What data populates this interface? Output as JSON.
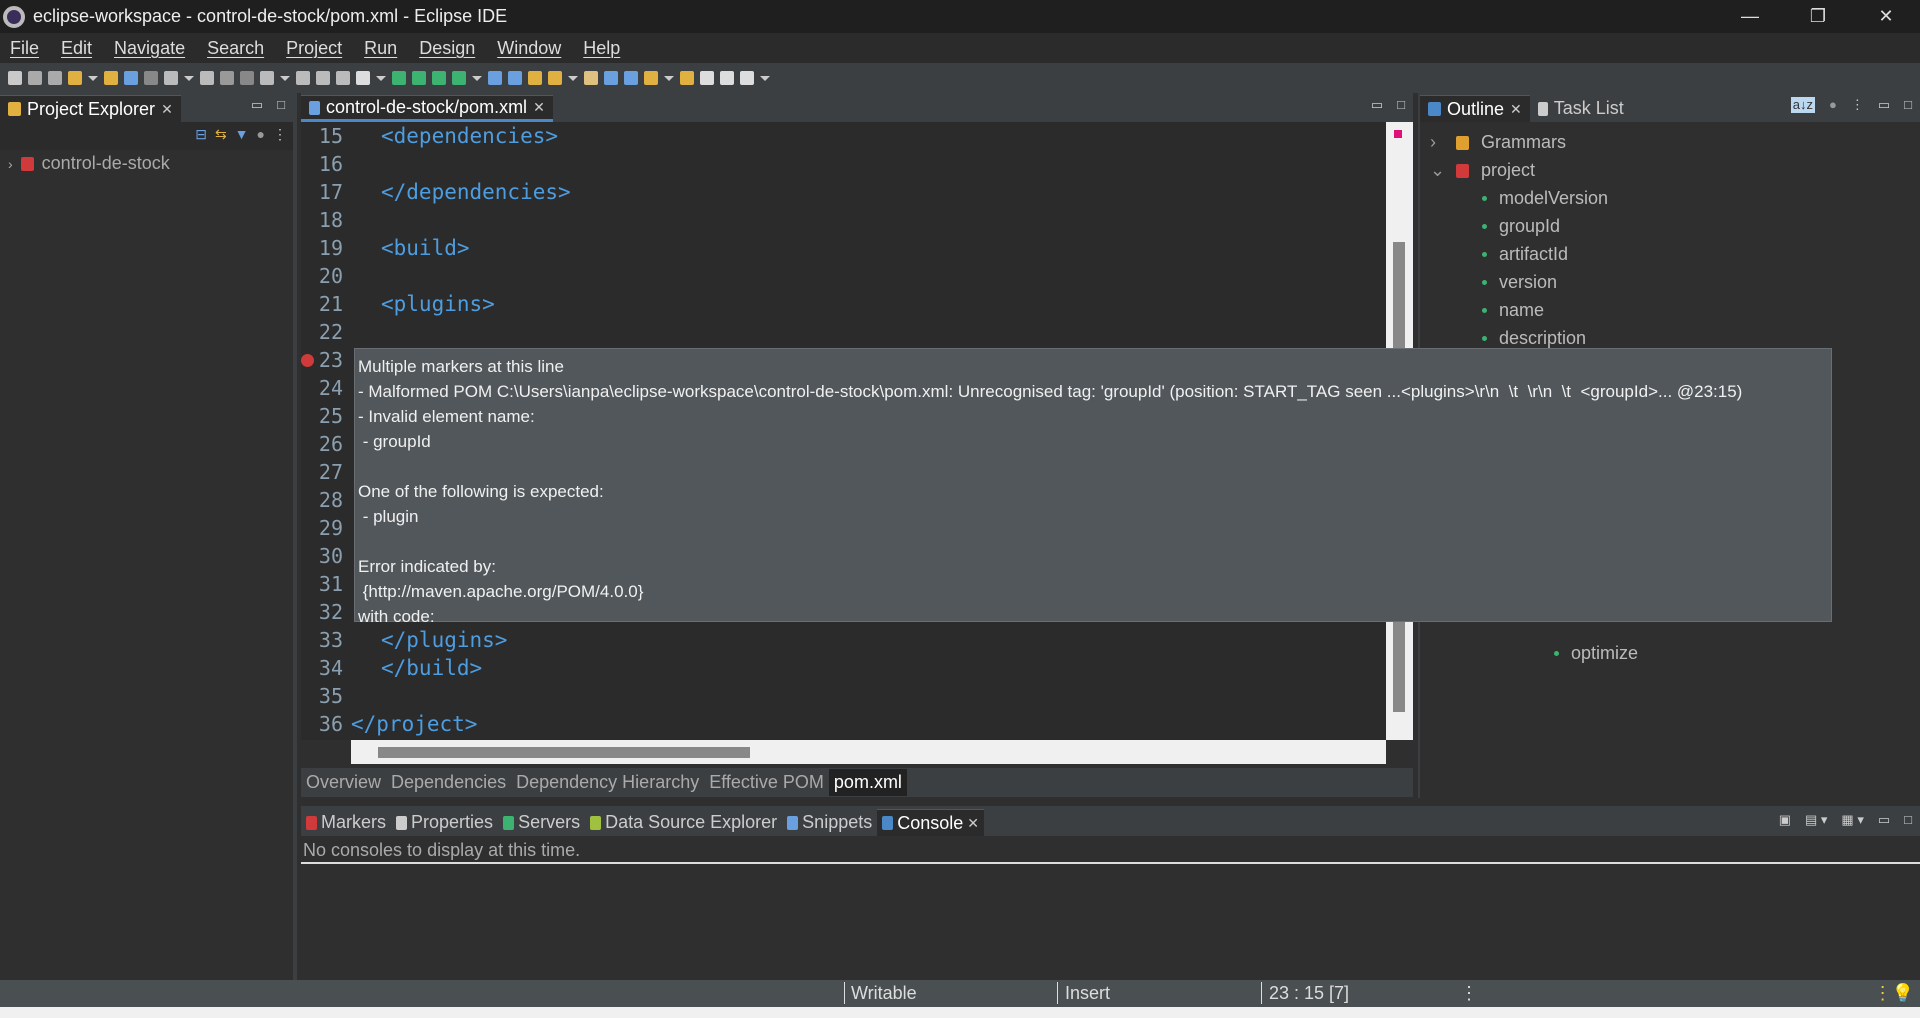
{
  "window": {
    "title": "eclipse-workspace - control-de-stock/pom.xml - Eclipse IDE",
    "controls": [
      "—",
      "❐",
      "✕"
    ]
  },
  "menu": [
    "File",
    "Edit",
    "Navigate",
    "Search",
    "Project",
    "Run",
    "Design",
    "Window",
    "Help"
  ],
  "toolbar": {
    "icons": [
      "new-icon",
      "save-icon",
      "save-all-icon",
      "open-type-icon",
      "open-resource-icon",
      "console-icon",
      "skip-breakpoints-icon",
      "resume-icon",
      "suspend-icon",
      "terminate-icon",
      "disconnect-icon",
      "step-into-icon",
      "step-over-icon",
      "step-return-icon",
      "drop-frame-icon",
      "use-step-filters-icon",
      "debug-icon",
      "run-icon",
      "coverage-icon",
      "run-external-icon",
      "new-server-icon",
      "new-service-icon",
      "open-folder-icon",
      "open-task-icon",
      "brush-icon",
      "web-browser-icon",
      "search-icon",
      "next-annotation-icon",
      "prev-annotation-icon",
      "back-icon",
      "forward-icon",
      "pin-icon"
    ],
    "colors": [
      "#c9c9c9",
      "#aaa",
      "#aaa",
      "#e0b040",
      "#e0b040",
      "#6aa0e0",
      "#888",
      "#bbb",
      "#bbb",
      "#999",
      "#888",
      "#bbb",
      "#bbb",
      "#bbb",
      "#bbb",
      "#ddd",
      "#3cb371",
      "#3cb371",
      "#3cb371",
      "#3cb371",
      "#6aa0e0",
      "#6aa0e0",
      "#e0b040",
      "#e0b040",
      "#e0c080",
      "#6aa0e0",
      "#6aa0e0",
      "#e0b040",
      "#e0b040",
      "#ddd",
      "#ddd",
      "#ddd"
    ]
  },
  "project_explorer": {
    "tab": "Project Explorer",
    "items": [
      {
        "label": "control-de-stock",
        "expanded": false
      }
    ]
  },
  "editor": {
    "tab": "control-de-stock/pom.xml",
    "lines": [
      {
        "n": "15",
        "code": "<dependencies>",
        "indent": 1
      },
      {
        "n": "16",
        "code": ""
      },
      {
        "n": "17",
        "code": "</dependencies>",
        "indent": 1
      },
      {
        "n": "18",
        "code": ""
      },
      {
        "n": "19",
        "code": "<build>",
        "indent": 1
      },
      {
        "n": "20",
        "code": ""
      },
      {
        "n": "21",
        "code": "<plugins>",
        "indent": 1
      },
      {
        "n": "22",
        "code": ""
      },
      {
        "n": "23",
        "code": "",
        "error": true
      },
      {
        "n": "24",
        "code": ""
      },
      {
        "n": "25",
        "code": ""
      },
      {
        "n": "26",
        "code": ""
      },
      {
        "n": "27",
        "code": ""
      },
      {
        "n": "28",
        "code": ""
      },
      {
        "n": "29",
        "code": ""
      },
      {
        "n": "30",
        "code": ""
      },
      {
        "n": "31",
        "code": ""
      },
      {
        "n": "32",
        "code": ""
      },
      {
        "n": "33",
        "code": "</plugins>",
        "indent": 1
      },
      {
        "n": "34",
        "code": "</build>",
        "indent": 1
      },
      {
        "n": "35",
        "code": ""
      },
      {
        "n": "36",
        "code": "</project>",
        "indent": 0
      }
    ],
    "bottom_tabs": [
      "Overview",
      "Dependencies",
      "Dependency Hierarchy",
      "Effective POM",
      "pom.xml"
    ],
    "active_bottom_tab": "pom.xml"
  },
  "tooltip": {
    "lines": [
      "Multiple markers at this line",
      "- Malformed POM C:\\Users\\ianpa\\eclipse-workspace\\control-de-stock\\pom.xml: Unrecognised tag: 'groupId' (position: START_TAG seen ...<plugins>\\r\\n  \\t  \\r\\n  \\t  <groupId>... @23:15)",
      "- Invalid element name:",
      " - groupId",
      "",
      "One of the following is expected:",
      " - plugin",
      "",
      "Error indicated by:",
      " {http://maven.apache.org/POM/4.0.0}",
      "with code:"
    ]
  },
  "outline": {
    "tabs": [
      "Outline",
      "Task List"
    ],
    "items": [
      {
        "label": "Grammars",
        "level": 0,
        "toggle": "›"
      },
      {
        "label": "project",
        "level": 0,
        "toggle": "⌄"
      },
      {
        "label": "modelVersion",
        "level": 1
      },
      {
        "label": "groupId",
        "level": 1
      },
      {
        "label": "artifactId",
        "level": 1
      },
      {
        "label": "version",
        "level": 1
      },
      {
        "label": "name",
        "level": 1
      },
      {
        "label": "description",
        "level": 1
      }
    ],
    "partial_item": {
      "label": "optimize",
      "level": 3
    }
  },
  "bottom_panel": {
    "tabs": [
      "Markers",
      "Properties",
      "Servers",
      "Data Source Explorer",
      "Snippets",
      "Console"
    ],
    "active": "Console",
    "message": "No consoles to display at this time."
  },
  "status": {
    "writable": "Writable",
    "mode": "Insert",
    "position": "23 : 15 [7]"
  }
}
